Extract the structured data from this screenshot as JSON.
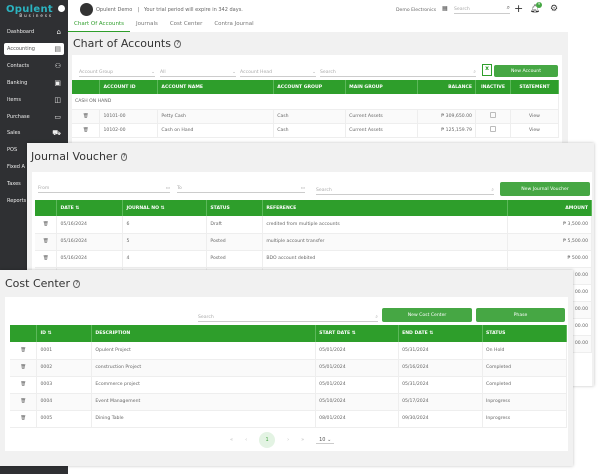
{
  "brand": {
    "name": "Opulent",
    "sub": "Business"
  },
  "sidebar": {
    "items": [
      {
        "label": "Dashboard",
        "icon": "home-icon"
      },
      {
        "label": "Accounting",
        "icon": "ledger-icon"
      },
      {
        "label": "Contacts",
        "icon": "user-plus-icon"
      },
      {
        "label": "Banking",
        "icon": "bank-icon"
      },
      {
        "label": "Items",
        "icon": "bag-icon"
      },
      {
        "label": "Purchase",
        "icon": "card-icon"
      },
      {
        "label": "Sales",
        "icon": "cart-icon"
      },
      {
        "label": "POS",
        "icon": "pos-icon"
      },
      {
        "label": "Fixed A",
        "icon": ""
      },
      {
        "label": "Taxes",
        "icon": ""
      },
      {
        "label": "Reports",
        "icon": ""
      }
    ]
  },
  "topbar": {
    "user": "Opulent Demo",
    "separator": "|",
    "trial": "Your trial period will expire in 342 days.",
    "company": "Demo Electronics",
    "search_placeholder": "Search",
    "notif_count": "9"
  },
  "tabs": [
    "Chart Of Accounts",
    "Journals",
    "Cost Center",
    "Contra Journal"
  ],
  "coa": {
    "title": "Chart of Accounts",
    "filters": {
      "group": "Account Group",
      "all": "All",
      "head": "Account Head",
      "search": "Search"
    },
    "new_button": "New Account",
    "columns": [
      "",
      "ACCOUNT ID",
      "ACCOUNT NAME",
      "ACCOUNT GROUP",
      "MAIN GROUP",
      "BALANCE",
      "INACTIVE",
      "STATEMENT"
    ],
    "section": "CASH ON HAND",
    "rows": [
      {
        "id": "10101-00",
        "name": "Petty Cash",
        "group": "Cash",
        "main": "Current Assets",
        "balance": "₱ 309,650.00",
        "statement": "View"
      },
      {
        "id": "10102-00",
        "name": "Cash on Hand",
        "group": "Cash",
        "main": "Current Assets",
        "balance": "₱ 125,159.79",
        "statement": "View"
      }
    ]
  },
  "jv": {
    "title": "Journal Voucher",
    "from": "From",
    "to": "To",
    "search": "Search",
    "new_button": "New Journal Voucher",
    "columns": [
      "",
      "DATE ⇅",
      "JOURNAL NO ⇅",
      "STATUS",
      "REFERENCE",
      "AMOUNT"
    ],
    "rows": [
      {
        "date": "05/16/2024",
        "no": "6",
        "status": "Draft",
        "ref": "credited from multiple accounts",
        "amount": "₱ 3,500.00"
      },
      {
        "date": "05/16/2024",
        "no": "5",
        "status": "Posted",
        "ref": "multiple account transfer",
        "amount": "₱ 5,500.00"
      },
      {
        "date": "05/16/2024",
        "no": "4",
        "status": "Posted",
        "ref": "BDO account debited",
        "amount": "₱ 500.00"
      }
    ],
    "hidden_amounts": [
      "00.00",
      "00.00",
      "00.00",
      "00.00",
      "00.00"
    ]
  },
  "cc": {
    "title": "Cost Center",
    "search": "Search",
    "new_button": "New Cost Center",
    "phase_button": "Phase",
    "columns": [
      "",
      "ID ⇅",
      "DESCRIPTION",
      "START DATE ⇅",
      "END DATE ⇅",
      "STATUS"
    ],
    "rows": [
      {
        "id": "0001",
        "desc": "Opulent Project",
        "start": "05/01/2024",
        "end": "05/31/2024",
        "status": "On Hold"
      },
      {
        "id": "0002",
        "desc": "construction Project",
        "start": "05/01/2024",
        "end": "05/16/2024",
        "status": "Completed"
      },
      {
        "id": "0003",
        "desc": "Ecommerce project",
        "start": "05/01/2024",
        "end": "05/31/2024",
        "status": "Completed"
      },
      {
        "id": "0004",
        "desc": "Event Management",
        "start": "05/10/2024",
        "end": "05/17/2024",
        "status": "Inprogress"
      },
      {
        "id": "0005",
        "desc": "Dining Table",
        "start": "08/01/2024",
        "end": "09/30/2024",
        "status": "Inprogress"
      }
    ],
    "pagination": {
      "first": "«",
      "prev": "‹",
      "page": "1",
      "next": "›",
      "last": "»",
      "per_page": "10"
    }
  },
  "colors": {
    "green": "#2e9e2b",
    "sidebar": "#2f3033"
  }
}
